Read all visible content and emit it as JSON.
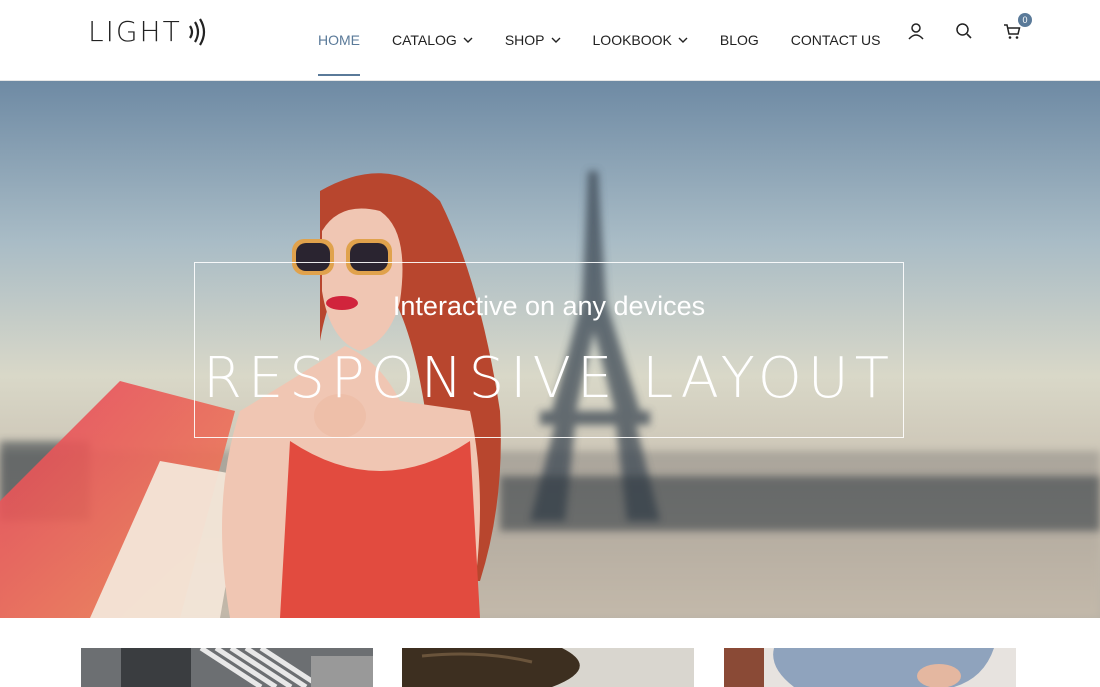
{
  "brand": {
    "name": "LIGHT",
    "logo_icon": "sound-waves-icon"
  },
  "nav": {
    "items": [
      {
        "label": "HOME",
        "has_dropdown": false,
        "active": true
      },
      {
        "label": "CATALOG",
        "has_dropdown": true,
        "active": false
      },
      {
        "label": "SHOP",
        "has_dropdown": true,
        "active": false
      },
      {
        "label": "LOOKBOOK",
        "has_dropdown": true,
        "active": false
      },
      {
        "label": "BLOG",
        "has_dropdown": false,
        "active": false
      },
      {
        "label": "CONTACT US",
        "has_dropdown": false,
        "active": false
      }
    ],
    "icons": [
      "user-icon",
      "search-icon",
      "cart-icon"
    ],
    "cart_count": "0"
  },
  "hero": {
    "subtitle": "Interactive on any devices",
    "title": "RESPONSIVE LAYOUT"
  },
  "colors": {
    "accent": "#5a7a99",
    "text": "#222222"
  },
  "products": [
    {
      "name": "product-thumb-1"
    },
    {
      "name": "product-thumb-2"
    },
    {
      "name": "product-thumb-3"
    }
  ]
}
